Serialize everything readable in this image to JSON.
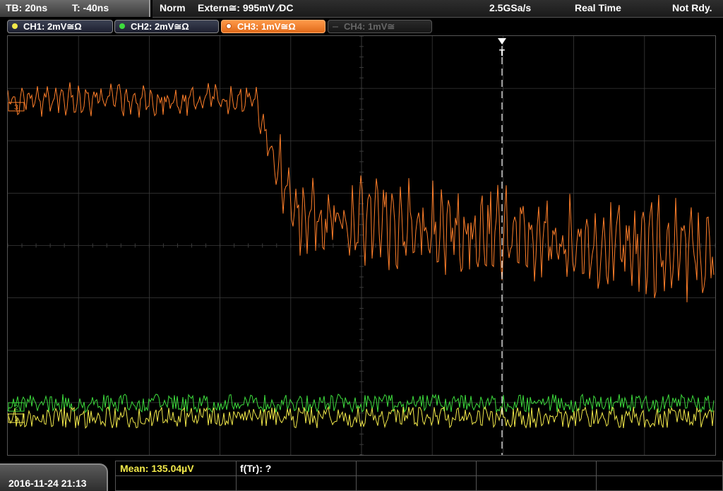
{
  "topbar": {
    "timebase": "TB: 20ns",
    "trigger_time": "T: -40ns",
    "mode": "Norm",
    "trigger_source": "Extern≅: 995mV ⁄DC",
    "sample_rate": "2.5GSa/s",
    "acq_mode": "Real Time",
    "status": "Not Rdy."
  },
  "channels": [
    {
      "label": "CH1: 2mV≅Ω",
      "color": "#f2e94a",
      "state": "on"
    },
    {
      "label": "CH2: 2mV≅Ω",
      "color": "#3ddc3d",
      "state": "on"
    },
    {
      "label": "CH3: 1mV≅Ω",
      "color": "#ff7f2a",
      "state": "selected"
    },
    {
      "label": "CH4: 1mV≅",
      "color": "#555555",
      "state": "off"
    }
  ],
  "markers": {
    "trigger_marker": "T",
    "ch3_ref": "3",
    "ch1_ref": "1",
    "ch2_ref": "2"
  },
  "colors": {
    "ch1": "#f2e94a",
    "ch2": "#3ddc3d",
    "ch3": "#ff7f2a",
    "grid": "#3a3a3a"
  },
  "bottombar": {
    "datetime": "2016-11-24 21:13",
    "measurements": [
      {
        "label": "Mean: 135.04µV",
        "color": "#f2e94a"
      },
      {
        "label": "f(Tr): ?",
        "color": "#ffffff"
      }
    ]
  }
}
